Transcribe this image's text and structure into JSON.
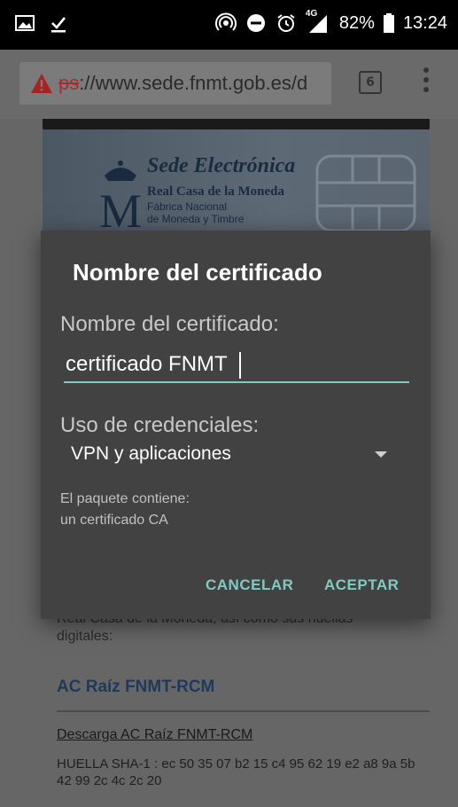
{
  "status_bar": {
    "network": "4G",
    "battery": "82%",
    "time": "13:24"
  },
  "browser": {
    "url_scheme": "ps",
    "url_rest": "://www.sede.fnmt.gob.es/d",
    "tab_count": "6"
  },
  "banner": {
    "title": "Sede Electrónica",
    "subtitle1": "Real Casa de la Moneda",
    "subtitle2": "Fábrica Nacional",
    "subtitle3": "de Moneda y Timbre"
  },
  "dialog": {
    "title": "Nombre del certificado",
    "name_label": "Nombre del certificado:",
    "name_value": "certificado FNMT",
    "usage_label": "Uso de credenciales:",
    "usage_selected": "VPN y aplicaciones",
    "package_label": "El paquete contiene:",
    "package_content": "un certificado CA",
    "cancel_label": "CANCELAR",
    "ok_label": "ACEPTAR",
    "accent_color": "#7fcbc4"
  },
  "page": {
    "partial_text": "Real Casa de la Moneda, así como sus huellas digitales:",
    "ac_title": "AC Raíz FNMT-RCM",
    "download_link": "Descarga AC Raíz FNMT-RCM",
    "fingerprint": "HUELLA SHA-1 : ec 50 35 07 b2 15 c4 95 62 19 e2 a8 9a 5b 42 99 2c 4c 2c 20"
  }
}
